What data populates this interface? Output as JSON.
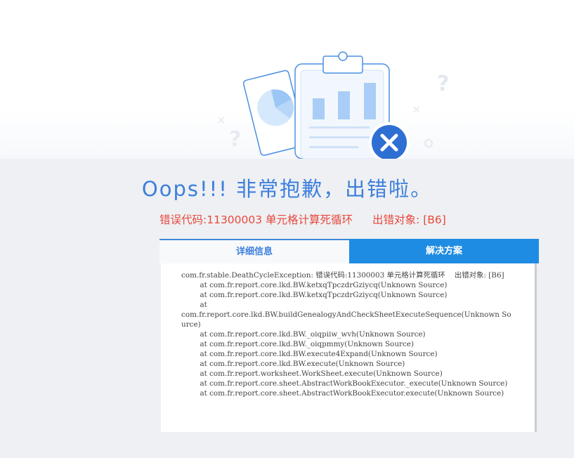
{
  "headline": "Oops!!! 非常抱歉，出错啦。",
  "error": {
    "code_text": "错误代码:11300003 单元格计算死循环",
    "object_text": "出错对象: [B6]"
  },
  "tabs": [
    {
      "label": "详细信息",
      "active": true
    },
    {
      "label": "解决方案",
      "active": false
    }
  ],
  "stack_trace": "com.fr.stable.DeathCycleException: 错误代码:11300003 单元格计算死循环    出错对象: [B6]\n        at com.fr.report.core.lkd.BW.ketxqTpczdrGziycq(Unknown Source)\n        at com.fr.report.core.lkd.BW.ketxqTpczdrGziycq(Unknown Source)\n        at\ncom.fr.report.core.lkd.BW.buildGenealogyAndCheckSheetExecuteSequence(Unknown Source)\n        at com.fr.report.core.lkd.BW._oiqpiiw_wvh(Unknown Source)\n        at com.fr.report.core.lkd.BW._oiqpmmy(Unknown Source)\n        at com.fr.report.core.lkd.BW.execute4Expand(Unknown Source)\n        at com.fr.report.core.lkd.BW.execute(Unknown Source)\n        at com.fr.report.worksheet.WorkSheet.execute(Unknown Source)\n        at com.fr.report.core.sheet.AbstractWorkBookExecutor._execute(Unknown Source)\n        at com.fr.report.core.sheet.AbstractWorkBookExecutor.execute(Unknown Source)",
  "colors": {
    "accent": "#3d7fdc",
    "error": "#e8483c",
    "tab_active_bg": "#1f8ce3"
  }
}
